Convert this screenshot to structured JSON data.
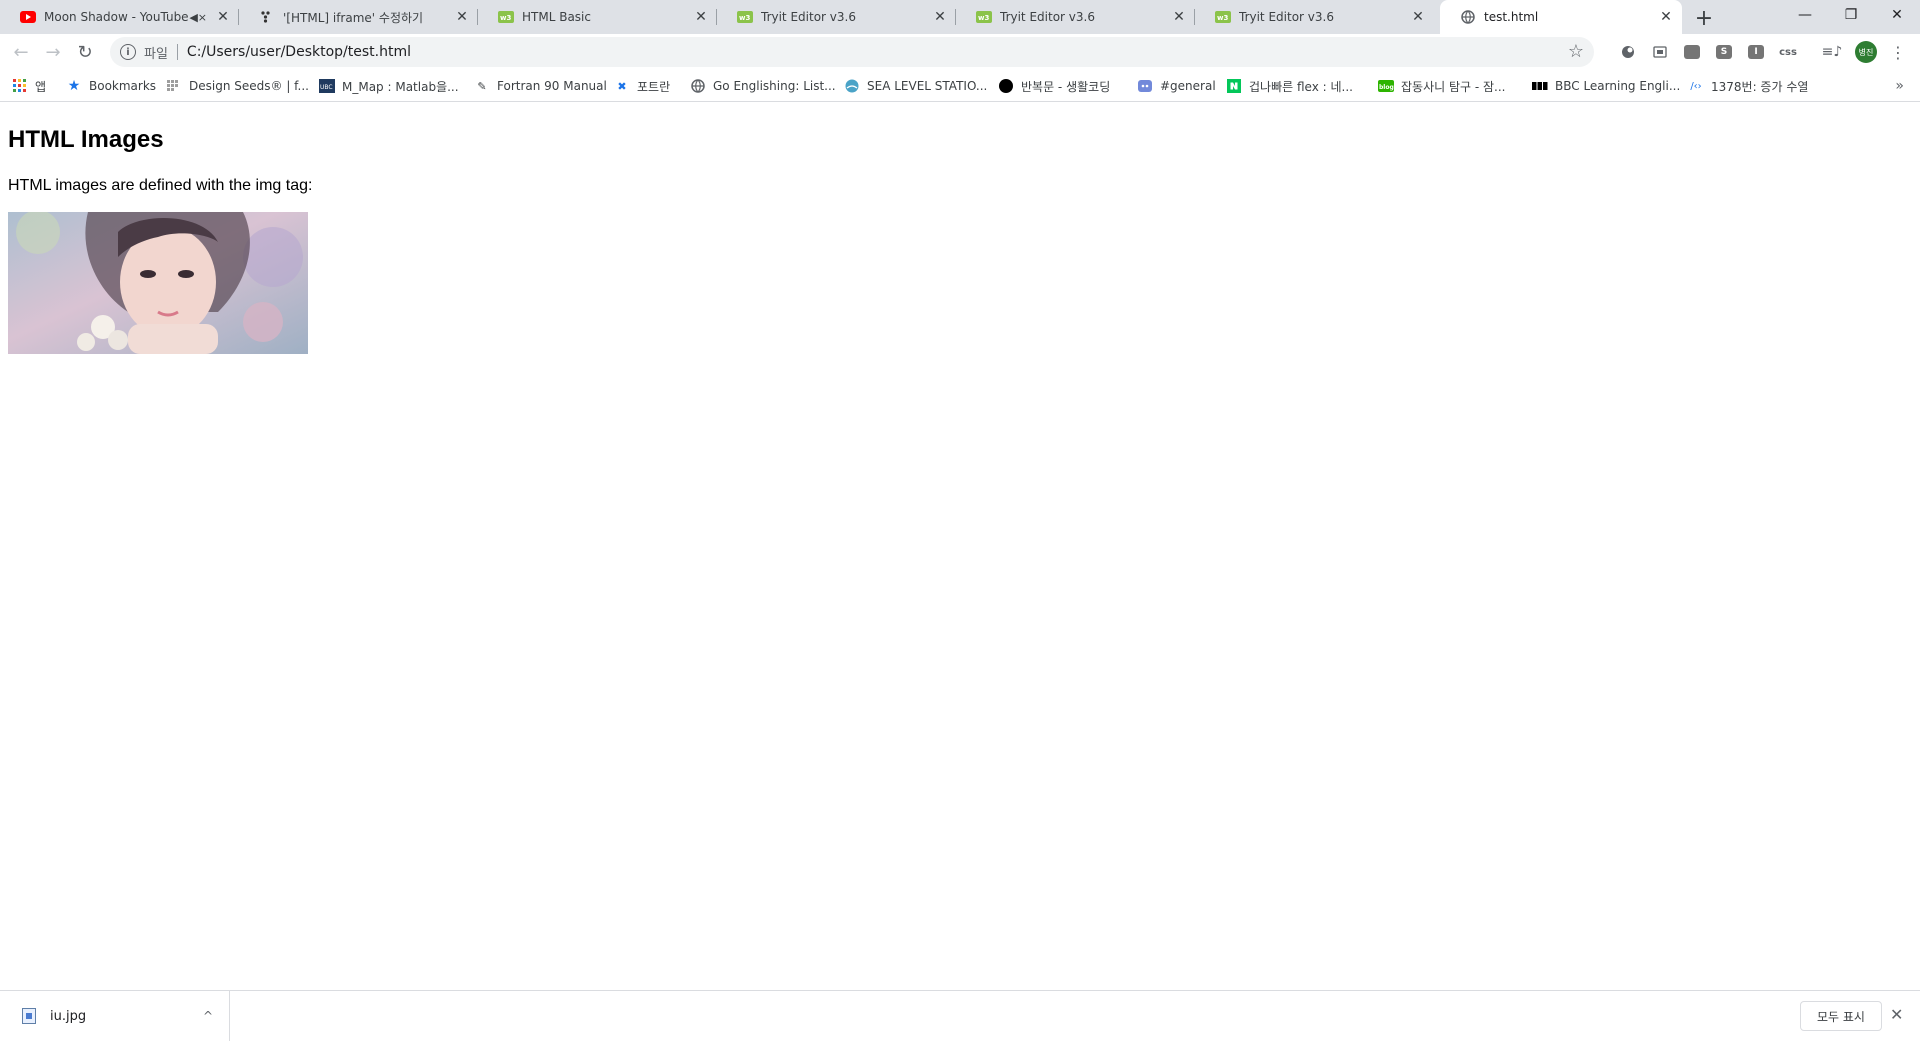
{
  "tabs": [
    {
      "title": "Moon Shadow - YouTube",
      "favicon": "youtube-icon",
      "muted": true,
      "active": false
    },
    {
      "title": "'[HTML] iframe' 수정하기",
      "favicon": "velog-icon",
      "active": false
    },
    {
      "title": "HTML Basic",
      "favicon": "w3schools-icon",
      "active": false
    },
    {
      "title": "Tryit Editor v3.6",
      "favicon": "w3schools-icon",
      "active": false
    },
    {
      "title": "Tryit Editor v3.6",
      "favicon": "w3schools-icon",
      "active": false
    },
    {
      "title": "Tryit Editor v3.6",
      "favicon": "w3schools-icon",
      "active": false
    },
    {
      "title": "test.html",
      "favicon": "globe-icon",
      "active": true
    }
  ],
  "toolbar": {
    "scheme_label": "파일",
    "url": "C:/Users/user/Desktop/test.html",
    "profile_initials": "병진",
    "extensions": [
      "",
      "",
      "",
      "S",
      "I",
      "css"
    ]
  },
  "bookmarks": {
    "items": [
      {
        "label": "앱",
        "icon": "apps-grid-icon"
      },
      {
        "label": "Bookmarks",
        "icon": "star-icon"
      },
      {
        "label": "Design Seeds® | f...",
        "icon": "design-seeds-icon"
      },
      {
        "label": "M_Map : Matlab을...",
        "icon": "mmap-icon"
      },
      {
        "label": "Fortran 90 Manual",
        "icon": "fortran-icon"
      },
      {
        "label": "포트란",
        "icon": "fortran-cross-icon"
      },
      {
        "label": "Go Englishing: List...",
        "icon": "globe-icon"
      },
      {
        "label": "SEA LEVEL STATIO...",
        "icon": "sea-level-icon"
      },
      {
        "label": "반복문 - 생활코딩",
        "icon": "circle-icon"
      },
      {
        "label": "#general",
        "icon": "discord-icon"
      },
      {
        "label": "겁나빠른 flex : 네...",
        "icon": "naver-icon"
      },
      {
        "label": "잡동사니 탐구 - 잠...",
        "icon": "blog-icon"
      },
      {
        "label": "BBC Learning Engli...",
        "icon": "bbc-icon"
      },
      {
        "label": "1378번: 증가 수열",
        "icon": "code-icon"
      }
    ]
  },
  "page": {
    "heading": "HTML Images",
    "paragraph": "HTML images are defined with the img tag:"
  },
  "downloads": {
    "file_name": "iu.jpg",
    "show_all_label": "모두 표시"
  }
}
